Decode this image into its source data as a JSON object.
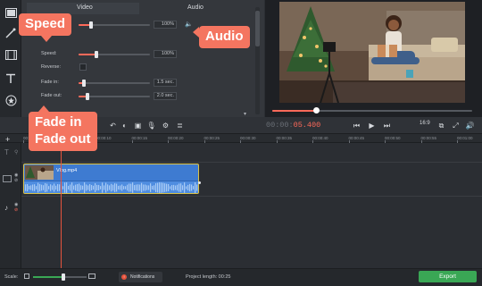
{
  "properties": {
    "tab_video": "Video",
    "tab_audio": "Audio",
    "row1_value": "100%",
    "speed_label": "Speed:",
    "speed_value": "100%",
    "reverse_label": "Reverse:",
    "fade_in_label": "Fade in:",
    "fade_in_value": "1.5 sec.",
    "fade_out_label": "Fade out:",
    "fade_out_value": "2.0 sec.",
    "row1_level": 0.18,
    "speed_level": 0.25,
    "fade_in_level": 0.08,
    "fade_out_level": 0.12
  },
  "preview": {
    "playback_progress": 0.22
  },
  "toolbar": {
    "timecode_elapsed": "00:00:",
    "timecode_frame": "05.400",
    "aspect_label": "16:9"
  },
  "timeline": {
    "ticks": [
      "00:00:00",
      "00:00:05",
      "00:00:10",
      "00:00:15",
      "00:00:20",
      "00:00:25",
      "00:00:30",
      "00:00:35",
      "00:00:40",
      "00:00:45",
      "00:00:50",
      "00:00:55",
      "00:01:00"
    ],
    "clip_name": "Vlog.mp4"
  },
  "statusbar": {
    "scale_label": "Scale:",
    "notifications_label": "Notifications",
    "project_length": "Project length: 00:25",
    "export_label": "Export"
  },
  "callouts": {
    "speed": "Speed",
    "audio": "Audio",
    "fade_line1": "Fade in",
    "fade_line2": "Fade out"
  },
  "colors": {
    "accent": "#f47560",
    "clip_blue": "#3e7bd1",
    "export_green": "#3aa755",
    "playhead": "#e5533d"
  }
}
